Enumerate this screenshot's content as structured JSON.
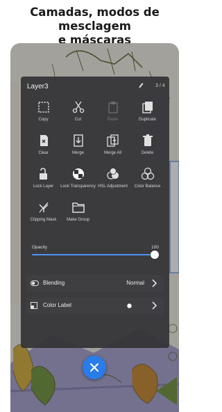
{
  "headline": {
    "line1": "Camadas, modos de mesclagem",
    "line2": "e máscaras"
  },
  "panel": {
    "title": "Layer3",
    "counter": "3 / 4",
    "tools": [
      {
        "label": "Copy",
        "icon": "copy-selection-icon",
        "enabled": true
      },
      {
        "label": "Cut",
        "icon": "scissors-icon",
        "enabled": true
      },
      {
        "label": "Paste",
        "icon": "paste-icon",
        "enabled": false
      },
      {
        "label": "Duplicate",
        "icon": "duplicate-icon",
        "enabled": true
      },
      {
        "label": "Clear",
        "icon": "clear-layer-icon",
        "enabled": true
      },
      {
        "label": "Merge",
        "icon": "merge-icon",
        "enabled": true
      },
      {
        "label": "Merge All",
        "icon": "merge-all-icon",
        "enabled": true
      },
      {
        "label": "Delete",
        "icon": "trash-icon",
        "enabled": true
      },
      {
        "label": "Lock Layer",
        "icon": "lock-open-icon",
        "enabled": true
      },
      {
        "label": "Lock Transparency",
        "icon": "checker-circle-icon",
        "enabled": true
      },
      {
        "label": "HSL Adjustment",
        "icon": "hsl-icon",
        "enabled": true
      },
      {
        "label": "Color Balance",
        "icon": "color-balance-icon",
        "enabled": true
      },
      {
        "label": "Clipping Mask",
        "icon": "clipping-mask-icon",
        "enabled": true
      },
      {
        "label": "Make Group",
        "icon": "folder-icon",
        "enabled": true
      }
    ],
    "opacity": {
      "label": "Opacity",
      "value": "100",
      "level": 1.0
    },
    "blending": {
      "label": "Blending",
      "value": "Normal"
    },
    "color_label": {
      "label": "Color Label"
    }
  },
  "colors": {
    "accent": "#2a7de8",
    "panel": "#343437",
    "artwork_fill": "#aba7d2",
    "line_art": "#6b6b3a"
  }
}
